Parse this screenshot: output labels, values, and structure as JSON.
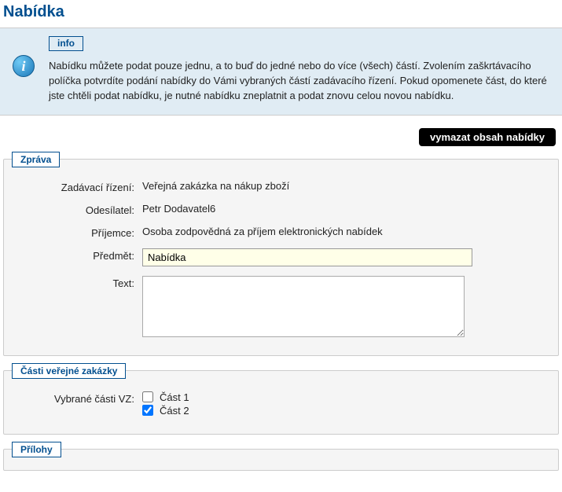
{
  "page": {
    "title": "Nabídka"
  },
  "info": {
    "badge": "info",
    "text": "Nabídku můžete podat pouze jednu, a to buď do jedné nebo do více (všech) částí. Zvolením zaškrtávacího políčka potvrdíte podání nabídky do Vámi vybraných částí zadávacího řízení. Pokud opomenete část, do které jste chtěli podat nabídku, je nutné nabídku zneplatnit a podat znovu celou novou nabídku."
  },
  "actions": {
    "clear": "vymazat obsah nabídky"
  },
  "message": {
    "legend": "Zpráva",
    "labels": {
      "procedure": "Zadávací řízení:",
      "sender": "Odesílatel:",
      "recipient": "Příjemce:",
      "subject": "Předmět:",
      "text": "Text:"
    },
    "values": {
      "procedure": "Veřejná zakázka na nákup zboží",
      "sender": "Petr Dodavatel6",
      "recipient": "Osoba zodpovědná za příjem elektronických nabídek",
      "subject": "Nabídka",
      "text": ""
    }
  },
  "parts": {
    "legend": "Části veřejné zakázky",
    "label": "Vybrané části VZ:",
    "items": [
      {
        "label": "Část 1",
        "checked": false
      },
      {
        "label": "Část 2",
        "checked": true
      }
    ]
  },
  "attachments": {
    "legend": "Přílohy"
  }
}
